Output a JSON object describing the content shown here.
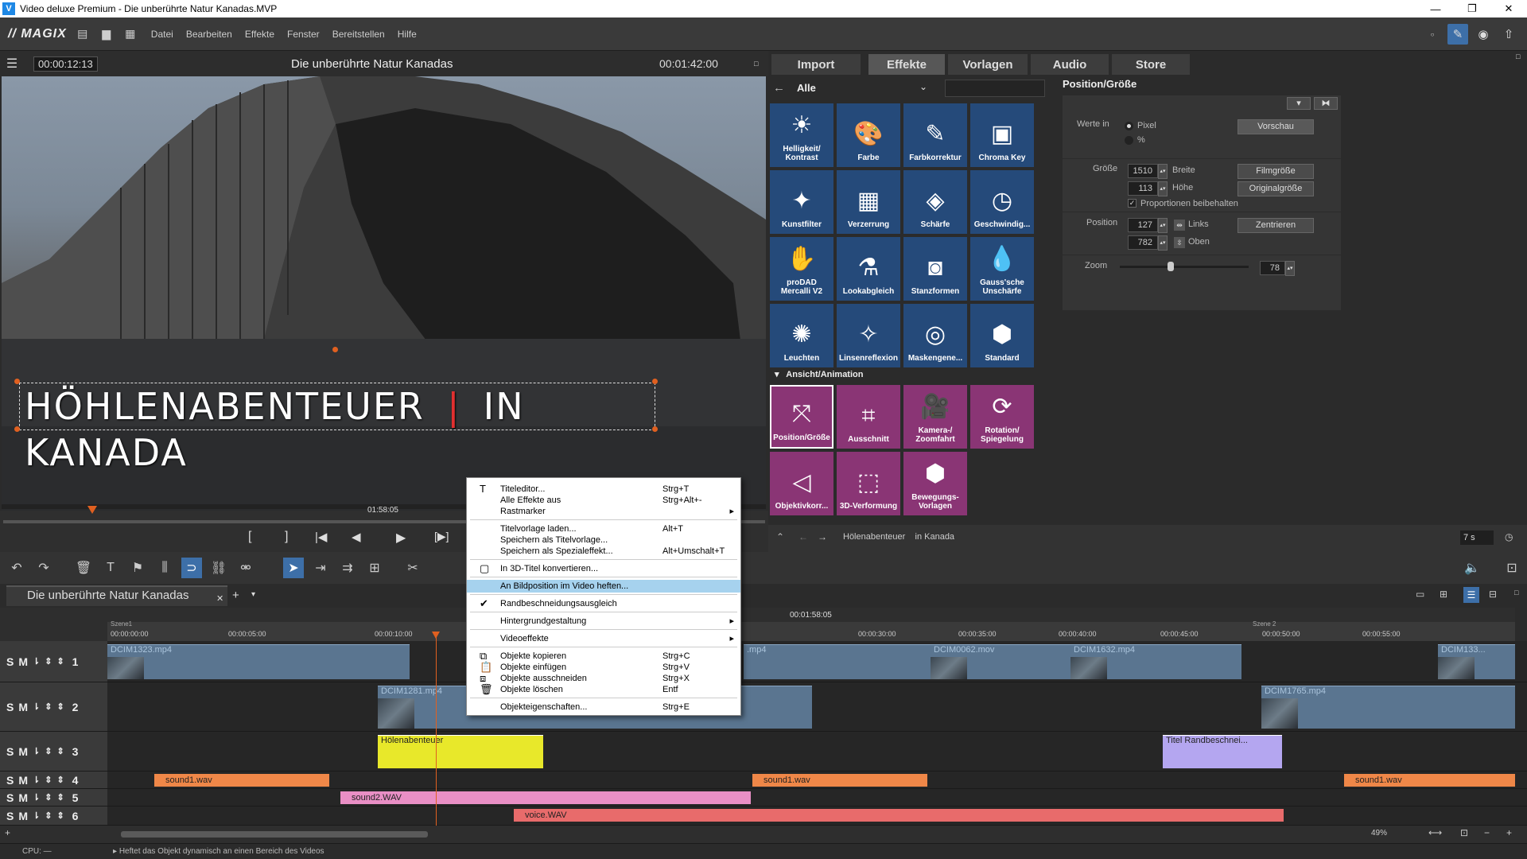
{
  "window": {
    "title": "Video deluxe Premium - Die unberührte Natur Kanadas.MVP",
    "app_icon": "V"
  },
  "menu": {
    "logo": "MAGIX",
    "items": [
      "Datei",
      "Bearbeiten",
      "Effekte",
      "Fenster",
      "Bereitstellen",
      "Hilfe"
    ]
  },
  "preview": {
    "timecode_left": "00:00:12:13",
    "title": "Die unberührte Natur Kanadas",
    "timecode_right": "00:01:42:00",
    "overlay_text": "HÖHLENABENTEUER",
    "overlay_text2": "IN KANADA",
    "scrub_time": "01:58:05"
  },
  "tabs": [
    "Import",
    "Effekte",
    "Vorlagen",
    "Audio",
    "Store"
  ],
  "effects": {
    "filter_label": "Alle",
    "section_label": "Ansicht/Animation",
    "grid1": [
      {
        "label": "Helligkeit/\nKontrast",
        "icon": "sun-icon",
        "glyph": "☀"
      },
      {
        "label": "Farbe",
        "icon": "palette-icon",
        "glyph": "🎨"
      },
      {
        "label": "Farbkorrektur",
        "icon": "palette-brush-icon",
        "glyph": "✎"
      },
      {
        "label": "Chroma Key",
        "icon": "chroma-key-icon",
        "glyph": "▣"
      },
      {
        "label": "Kunstfilter",
        "icon": "art-filter-icon",
        "glyph": "✦"
      },
      {
        "label": "Verzerrung",
        "icon": "distortion-icon",
        "glyph": "▦"
      },
      {
        "label": "Schärfe",
        "icon": "sharpness-icon",
        "glyph": "◈"
      },
      {
        "label": "Geschwindig...",
        "icon": "speed-icon",
        "glyph": "◷"
      },
      {
        "label": "proDAD\nMercalli V2",
        "icon": "hand-icon",
        "glyph": "✋"
      },
      {
        "label": "Lookabgleich",
        "icon": "look-match-icon",
        "glyph": "⚗"
      },
      {
        "label": "Stanzformen",
        "icon": "punch-shapes-icon",
        "glyph": "◙"
      },
      {
        "label": "Gauss'sche\nUnschärfe",
        "icon": "drop-icon",
        "glyph": "💧"
      },
      {
        "label": "Leuchten",
        "icon": "glow-icon",
        "glyph": "✺"
      },
      {
        "label": "Linsenreflexion",
        "icon": "lens-flare-icon",
        "glyph": "✧"
      },
      {
        "label": "Maskengene...",
        "icon": "mask-icon",
        "glyph": "◎"
      },
      {
        "label": "Standard",
        "icon": "hexagon-icon",
        "glyph": "⬢"
      }
    ],
    "grid2": [
      {
        "label": "Position/Größe",
        "icon": "position-size-icon",
        "glyph": "⤧"
      },
      {
        "label": "Ausschnitt",
        "icon": "crop-icon",
        "glyph": "⌗"
      },
      {
        "label": "Kamera-/\nZoomfahrt",
        "icon": "camera-icon",
        "glyph": "🎥"
      },
      {
        "label": "Rotation/\nSpiegelung",
        "icon": "rotation-icon",
        "glyph": "⟳"
      },
      {
        "label": "Objektivkorr...",
        "icon": "lens-correction-icon",
        "glyph": "◁"
      },
      {
        "label": "3D-Verformung",
        "icon": "3d-warp-icon",
        "glyph": "⬚"
      },
      {
        "label": "Bewegungs-\nVorlagen",
        "icon": "motion-template-icon",
        "glyph": "⬢"
      }
    ],
    "breadcrumb": "Hölenabenteuer    in Kanada",
    "duration": "7 s"
  },
  "position_panel": {
    "title": "Position/Größe",
    "werte_in": "Werte in",
    "opt_pixel": "Pixel",
    "opt_percent": "%",
    "preview_btn": "Vorschau",
    "groesse": "Größe",
    "breite_val": "1510",
    "breite": "Breite",
    "hoehe_val": "113",
    "hoehe": "Höhe",
    "filmgroesse": "Filmgröße",
    "originalgroesse": "Originalgröße",
    "proportionen": "Proportionen beibehalten",
    "position": "Position",
    "links_val": "127",
    "links": "Links",
    "oben_val": "782",
    "oben": "Oben",
    "zentrieren": "Zentrieren",
    "zoom": "Zoom",
    "zoom_val": "78"
  },
  "project_tab": "Die unberührte Natur Kanadas",
  "ruler": {
    "labels": [
      "00:00:00:00",
      "00:00:05:00",
      "00:00:10:00",
      "00:00:30:00",
      "00:00:35:00",
      "00:00:40:00",
      "00:00:45:00",
      "00:00:50:00",
      "00:00:55:00"
    ],
    "top_time": "00:01:58:05",
    "scene1": "Szene1",
    "scene2": "Szene 2"
  },
  "tracks": [
    {
      "num": "1",
      "clips": [
        "DCIM1323.mp4",
        ".mp4",
        "DCIM0062.mov",
        "DCIM1632.mp4",
        "DCIM133..."
      ]
    },
    {
      "num": "2",
      "clips": [
        "DCIM1281.mp4",
        "DCIM1765.mp4"
      ]
    },
    {
      "num": "3",
      "clips": [
        "Hölenabenteuer",
        "Titel   Randbeschnei..."
      ]
    },
    {
      "num": "4",
      "clips": [
        "sound1.wav",
        "sound1.wav",
        "sound1.wav"
      ]
    },
    {
      "num": "5",
      "clips": [
        "sound2.WAV"
      ]
    },
    {
      "num": "6",
      "clips": [
        "voice.WAV"
      ]
    }
  ],
  "context_menu": [
    {
      "label": "Titeleditor...",
      "key": "Strg+T"
    },
    {
      "label": "Alle Effekte aus",
      "key": "Strg+Alt+-"
    },
    {
      "label": "Rastmarker",
      "key": ""
    },
    {
      "label": "Titelvorlage laden...",
      "key": "Alt+T"
    },
    {
      "label": "Speichern als Titelvorlage...",
      "key": ""
    },
    {
      "label": "Speichern als Spezialeffekt...",
      "key": "Alt+Umschalt+T"
    },
    {
      "label": "In 3D-Titel konvertieren...",
      "key": ""
    },
    {
      "label": "An Bildposition im Video heften...",
      "key": ""
    },
    {
      "label": "Randbeschneidungsausgleich",
      "key": ""
    },
    {
      "label": "Hintergrundgestaltung",
      "key": ""
    },
    {
      "label": "Videoeffekte",
      "key": ""
    },
    {
      "label": "Objekte kopieren",
      "key": "Strg+C"
    },
    {
      "label": "Objekte einfügen",
      "key": "Strg+V"
    },
    {
      "label": "Objekte ausschneiden",
      "key": "Strg+X"
    },
    {
      "label": "Objekte löschen",
      "key": "Entf"
    },
    {
      "label": "Objekteigenschaften...",
      "key": "Strg+E"
    }
  ],
  "zoom_level": "49%",
  "status": {
    "cpu": "CPU: —",
    "hint": "Heftet das Objekt dynamisch an einen Bereich des Videos"
  },
  "colors": {
    "effect_blue": "#254a7a",
    "effect_pink": "#8a3575",
    "menu_highlight": "#a6d2ee",
    "audio_orange": "#ef8748",
    "audio_pink": "#e98fc5",
    "voice_red": "#e86b6b",
    "title_yellow": "#e8e82a",
    "title_purple": "#b4a6f0"
  }
}
